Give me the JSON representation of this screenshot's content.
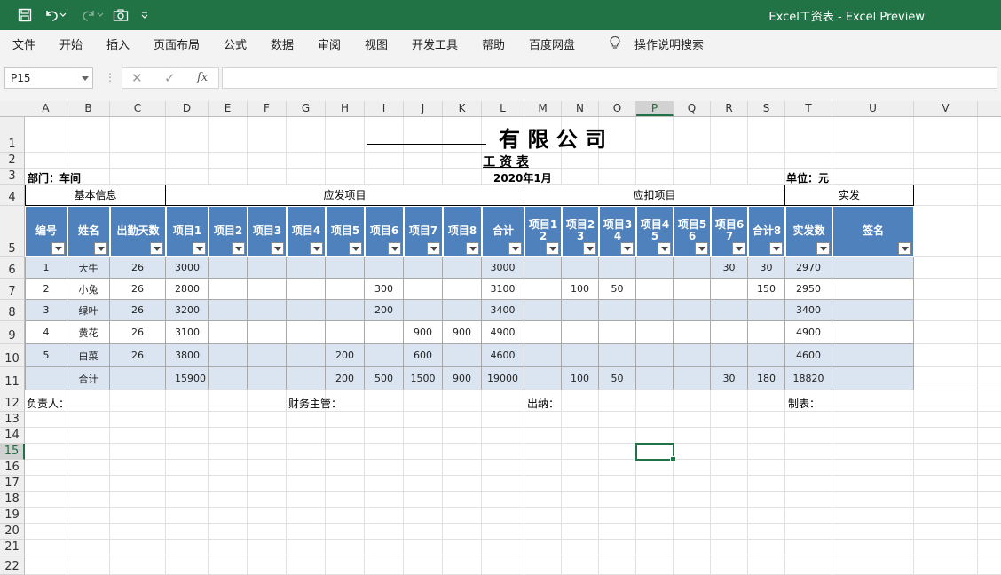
{
  "app": {
    "title": "Excel工资表  -  Excel Preview"
  },
  "menu": [
    "文件",
    "开始",
    "插入",
    "页面布局",
    "公式",
    "数据",
    "审阅",
    "视图",
    "开发工具",
    "帮助",
    "百度网盘"
  ],
  "tell_me": "操作说明搜索",
  "namebox": "P15",
  "columns": [
    "A",
    "B",
    "C",
    "D",
    "E",
    "F",
    "G",
    "H",
    "I",
    "J",
    "K",
    "L",
    "M",
    "N",
    "O",
    "P",
    "Q",
    "R",
    "S",
    "T",
    "U",
    "V"
  ],
  "selected_column": "P",
  "rows": [
    "1",
    "2",
    "3",
    "4",
    "5",
    "6",
    "7",
    "8",
    "9",
    "10",
    "11",
    "12",
    "13",
    "14",
    "15",
    "16",
    "17",
    "18",
    "19",
    "20",
    "21",
    "22"
  ],
  "selected_row": "15",
  "sheet": {
    "company_title": "有 限 公 司",
    "subtitle": "工  资  表",
    "dept": "部门：车间",
    "period": "2020年1月",
    "unit": "单位：元",
    "groups": {
      "basic": "基本信息",
      "income": "应发项目",
      "deduct": "应扣项目",
      "actual": "实发"
    },
    "headers": [
      "编号",
      "姓名",
      "出勤天数",
      "项目1",
      "项目2",
      "项目3",
      "项目4",
      "项目5",
      "项目6",
      "项目7",
      "项目8",
      "合计",
      "项目12",
      "项目23",
      "项目34",
      "项目45",
      "项目56",
      "项目67",
      "合计8",
      "实发数",
      "签名"
    ],
    "data_rows": [
      [
        "1",
        "大牛",
        "26",
        "3000",
        "",
        "",
        "",
        "",
        "",
        "",
        "",
        "3000",
        "",
        "",
        "",
        "",
        "",
        "30",
        "30",
        "2970",
        ""
      ],
      [
        "2",
        "小兔",
        "26",
        "2800",
        "",
        "",
        "",
        "",
        "300",
        "",
        "",
        "3100",
        "",
        "100",
        "50",
        "",
        "",
        "",
        "150",
        "2950",
        ""
      ],
      [
        "3",
        "绿叶",
        "26",
        "3200",
        "",
        "",
        "",
        "",
        "200",
        "",
        "",
        "3400",
        "",
        "",
        "",
        "",
        "",
        "",
        "",
        "3400",
        ""
      ],
      [
        "4",
        "黄花",
        "26",
        "3100",
        "",
        "",
        "",
        "",
        "",
        "900",
        "900",
        "4900",
        "",
        "",
        "",
        "",
        "",
        "",
        "",
        "4900",
        ""
      ],
      [
        "5",
        "白菜",
        "26",
        "3800",
        "",
        "",
        "",
        "200",
        "",
        "600",
        "",
        "4600",
        "",
        "",
        "",
        "",
        "",
        "",
        "",
        "4600",
        ""
      ]
    ],
    "total_row": [
      "",
      "合计",
      "",
      "15900",
      "",
      "",
      "",
      "200",
      "500",
      "1500",
      "900",
      "19000",
      "",
      "100",
      "50",
      "",
      "",
      "30",
      "180",
      "18820",
      ""
    ],
    "footer": {
      "responsible": "负责人：",
      "finance": "财务主管：",
      "cashier": "出纳：",
      "preparer": "制表："
    }
  }
}
